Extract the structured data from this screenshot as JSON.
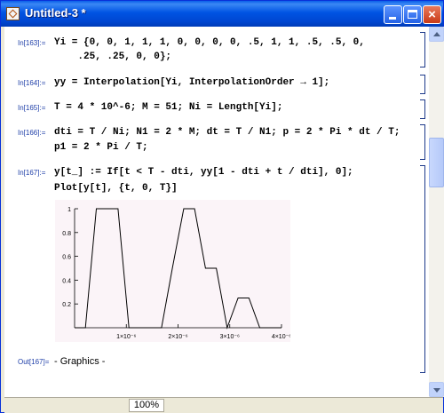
{
  "window": {
    "title": "Untitled-3 *",
    "controls": {
      "minimize": "minimize",
      "maximize": "maximize",
      "close": "×"
    }
  },
  "cells": [
    {
      "label": "In[163]:=",
      "lines": [
        "Yi = {0, 0, 1, 1, 1, 0, 0, 0, 0, .5, 1, 1, .5, .5, 0,",
        "    .25, .25, 0, 0};"
      ]
    },
    {
      "label": "In[164]:=",
      "lines": [
        "yy = Interpolation[Yi, InterpolationOrder → 1];"
      ]
    },
    {
      "label": "In[165]:=",
      "lines": [
        "T = 4 * 10^-6; M = 51; Ni = Length[Yi];"
      ]
    },
    {
      "label": "In[166]:=",
      "lines": [
        "dti = T / Ni; N1 = 2 * M; dt = T / N1; p = 2 * Pi * dt / T;",
        "p1 = 2 * Pi / T;"
      ]
    },
    {
      "label": "In[167]:=",
      "lines": [
        "y[t_] := If[t < T - dti, yy[1 - dti + t / dti], 0];",
        "Plot[y[t], {t, 0, T}]"
      ]
    }
  ],
  "output": {
    "label": "Out[167]=",
    "text": "- Graphics -"
  },
  "status": {
    "zoom": "100%"
  },
  "chart_data": {
    "type": "line",
    "x_ticks": [
      "1×10⁻⁶",
      "2×10⁻⁶",
      "3×10⁻⁶",
      "4×10⁻⁶"
    ],
    "x_tick_values": [
      1e-06,
      2e-06,
      3e-06,
      4e-06
    ],
    "y_ticks": [
      "0.2",
      "0.4",
      "0.6",
      "0.8",
      "1"
    ],
    "y_tick_values": [
      0.2,
      0.4,
      0.6,
      0.8,
      1
    ],
    "xlim": [
      0,
      4e-06
    ],
    "ylim": [
      0,
      1
    ],
    "series": [
      {
        "x": [
          0,
          2.1e-07,
          2.1e-07,
          4.2e-07,
          6.3e-07,
          8.4e-07,
          1.05e-06,
          1.26e-06,
          1.47e-06,
          1.68e-06,
          1.89e-06,
          2.11e-06,
          2.32e-06,
          2.53e-06,
          2.74e-06,
          2.95e-06,
          3.16e-06,
          3.37e-06,
          3.58e-06,
          3.79e-06,
          4e-06
        ],
        "y": [
          0,
          0,
          0,
          1,
          1,
          1,
          0,
          0,
          0,
          0,
          0.5,
          1,
          1,
          0.5,
          0.5,
          0,
          0.25,
          0.25,
          0,
          0,
          0
        ]
      }
    ],
    "colors": {
      "line": "#000000",
      "plot_bg": "#fbf4f8"
    }
  }
}
